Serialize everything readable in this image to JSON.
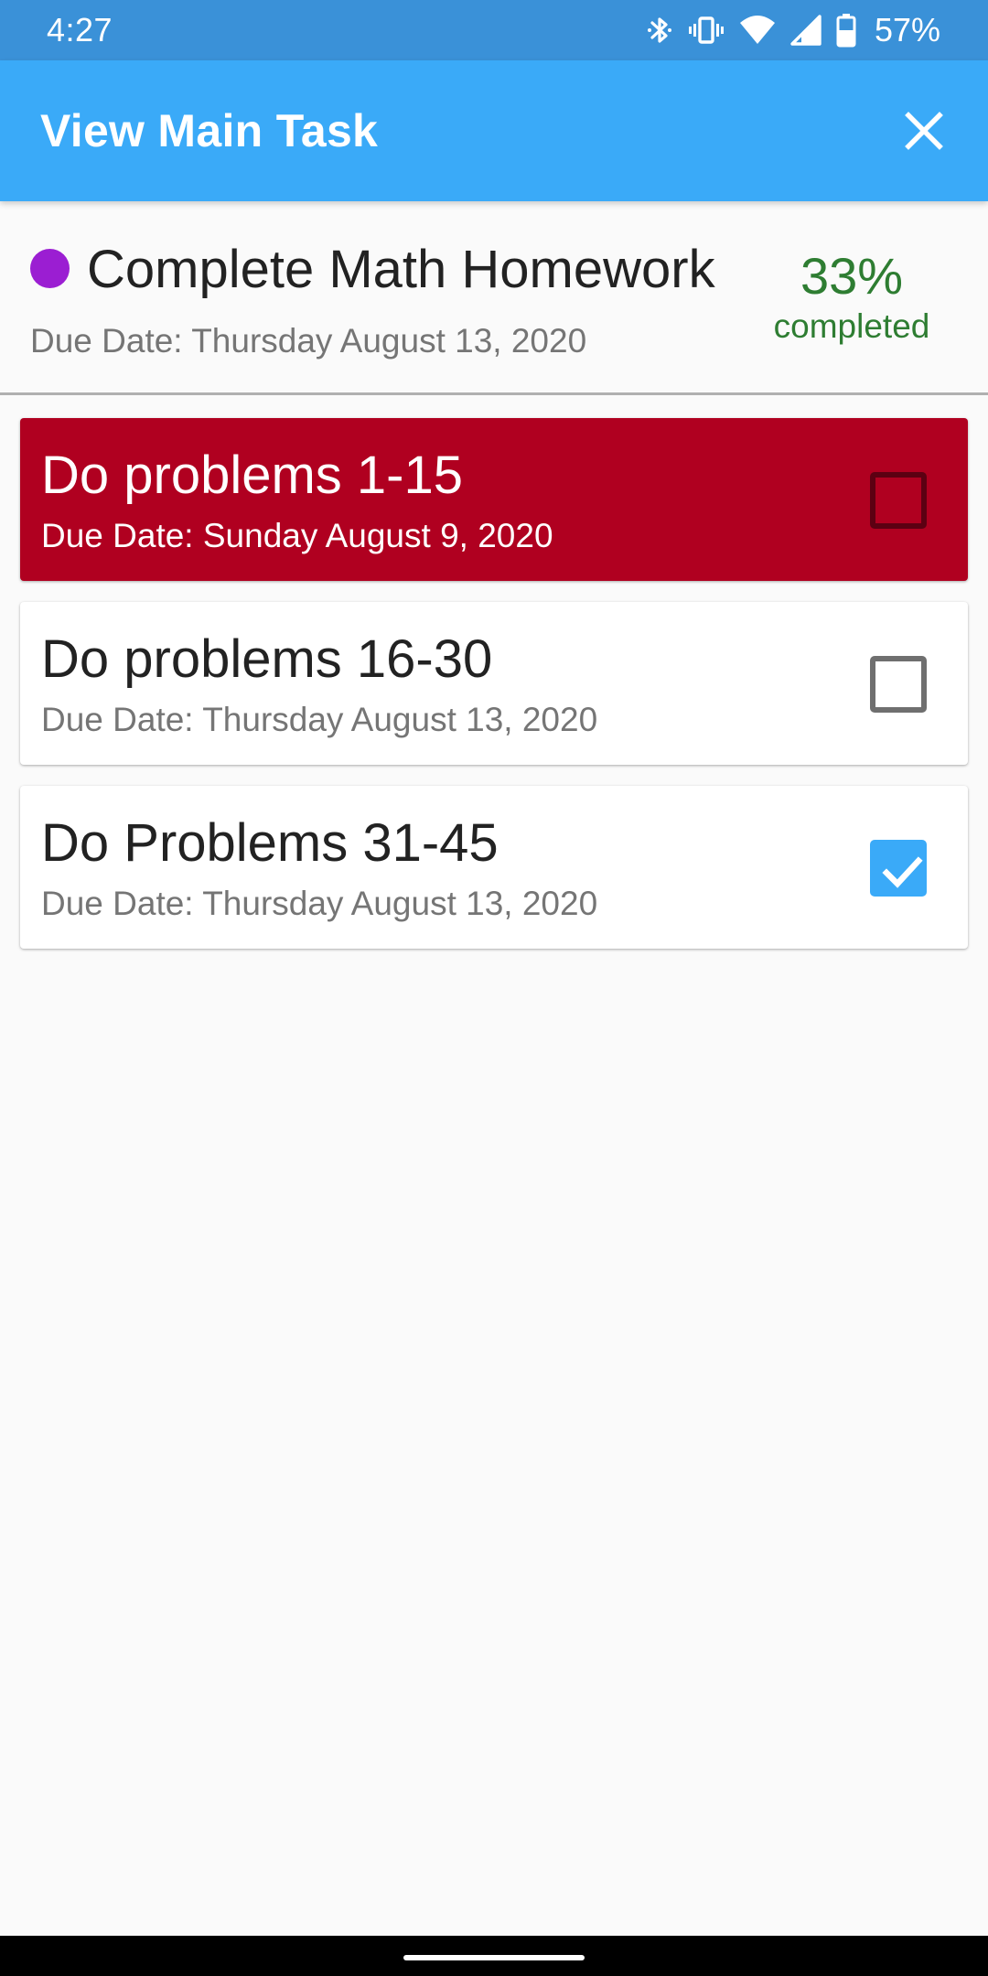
{
  "status_bar": {
    "time": "4:27",
    "battery": "57%",
    "icons": [
      "bluetooth-icon",
      "vibrate-icon",
      "wifi-icon",
      "signal-icon",
      "battery-icon"
    ]
  },
  "app_bar": {
    "title": "View Main Task",
    "close_icon": "close-icon",
    "color": "#3aaaf8"
  },
  "main_task": {
    "title": "Complete Math Homework",
    "due": "Due Date: Thursday August 13, 2020",
    "dot_color": "#9b1ed2",
    "progress_percent": "33%",
    "progress_label": "completed"
  },
  "subtasks": [
    {
      "title": "Do problems 1-15",
      "due": "Due Date: Sunday August 9, 2020",
      "checked": false,
      "status": "overdue",
      "background": "#b00020"
    },
    {
      "title": "Do problems 16-30",
      "due": "Due Date: Thursday August 13, 2020",
      "checked": false
    },
    {
      "title": "Do Problems 31-45",
      "due": "Due Date: Thursday August 13, 2020",
      "checked": true
    }
  ]
}
